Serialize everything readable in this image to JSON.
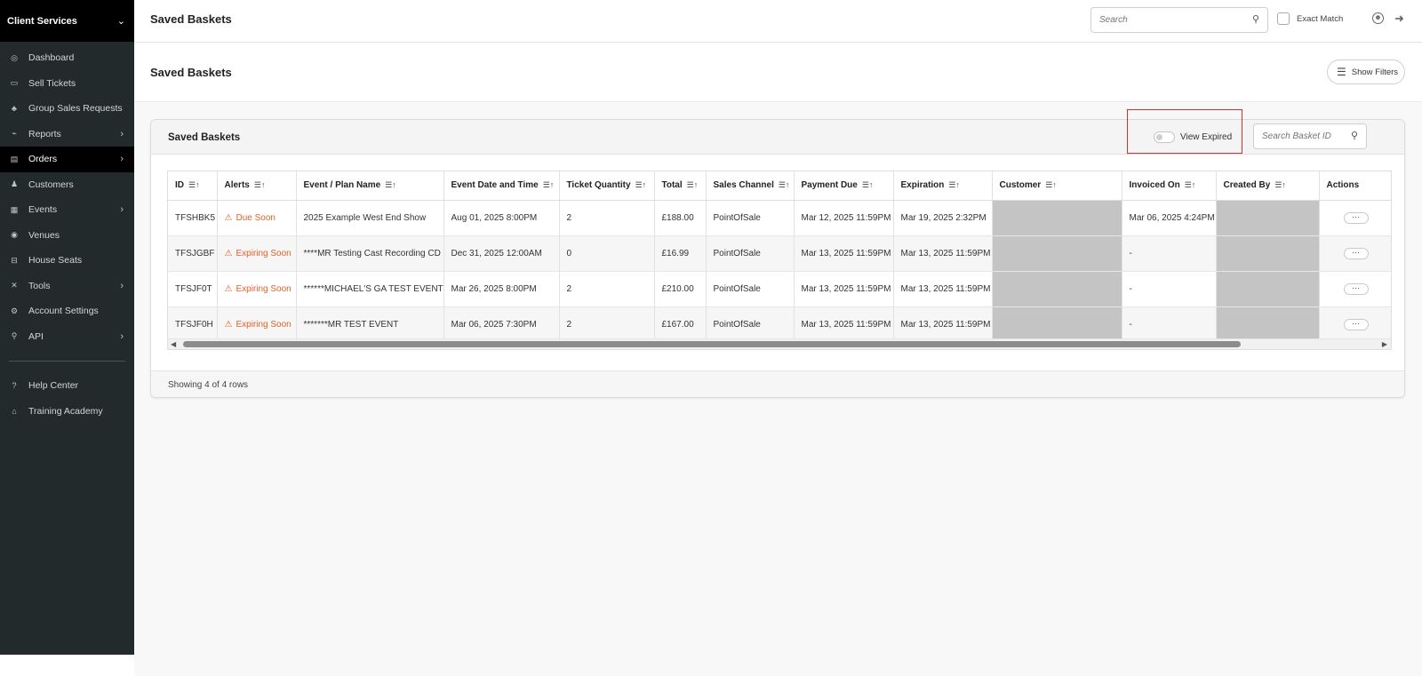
{
  "sidebar": {
    "header": "Client Services",
    "items": [
      {
        "label": "Dashboard",
        "icon": "dashboard-icon"
      },
      {
        "label": "Sell Tickets",
        "icon": "ticket-icon"
      },
      {
        "label": "Group Sales Requests",
        "icon": "group-icon"
      },
      {
        "label": "Reports",
        "icon": "chart-icon"
      },
      {
        "label": "Orders",
        "icon": "orders-icon"
      },
      {
        "label": "Customers",
        "icon": "users-icon"
      },
      {
        "label": "Events",
        "icon": "calendar-icon"
      },
      {
        "label": "Venues",
        "icon": "location-icon"
      },
      {
        "label": "House Seats",
        "icon": "seat-icon"
      },
      {
        "label": "Tools",
        "icon": "tools-icon"
      },
      {
        "label": "Account Settings",
        "icon": "settings-icon"
      },
      {
        "label": "API",
        "icon": "api-icon"
      }
    ],
    "bottom_items": [
      {
        "label": "Help Center",
        "icon": "help-icon"
      },
      {
        "label": "Training Academy",
        "icon": "academy-icon"
      }
    ]
  },
  "topbar": {
    "title": "Saved Baskets",
    "search_placeholder": "Search",
    "exact_match_label": "Exact Match"
  },
  "page": {
    "title": "Saved Baskets",
    "show_filters_label": "Show Filters"
  },
  "card": {
    "title": "Saved Baskets",
    "view_expired_label": "View Expired",
    "basket_search_placeholder": "Search Basket ID",
    "footer": "Showing 4 of 4 rows"
  },
  "table": {
    "columns": [
      "ID",
      "Alerts",
      "Event / Plan Name",
      "Event Date and Time",
      "Ticket Quantity",
      "Total",
      "Sales Channel",
      "Payment Due",
      "Expiration",
      "Customer",
      "Invoiced On",
      "Created By",
      "Actions"
    ],
    "rows": [
      {
        "id": "TFSHBK5",
        "alert": "Due Soon",
        "event": "2025 Example West End Show",
        "date": "Aug 01, 2025 8:00PM",
        "qty": "2",
        "total": "£188.00",
        "channel": "PointOfSale",
        "payment_due": "Mar 12, 2025 11:59PM",
        "expiration": "Mar 19, 2025 2:32PM",
        "invoiced": "Mar 06, 2025 4:24PM",
        "actions": "···"
      },
      {
        "id": "TFSJGBF",
        "alert": "Expiring Soon",
        "event": "****MR Testing Cast Recording CD",
        "date": "Dec 31, 2025 12:00AM",
        "qty": "0",
        "total": "£16.99",
        "channel": "PointOfSale",
        "payment_due": "Mar 13, 2025 11:59PM",
        "expiration": "Mar 13, 2025 11:59PM",
        "invoiced": "-",
        "actions": "···"
      },
      {
        "id": "TFSJF0T",
        "alert": "Expiring Soon",
        "event": "******MICHAEL'S GA TEST EVENT",
        "date": "Mar 26, 2025 8:00PM",
        "qty": "2",
        "total": "£210.00",
        "channel": "PointOfSale",
        "payment_due": "Mar 13, 2025 11:59PM",
        "expiration": "Mar 13, 2025 11:59PM",
        "invoiced": "-",
        "actions": "···"
      },
      {
        "id": "TFSJF0H",
        "alert": "Expiring Soon",
        "event": "*******MR TEST EVENT",
        "date": "Mar 06, 2025 7:30PM",
        "qty": "2",
        "total": "£167.00",
        "channel": "PointOfSale",
        "payment_due": "Mar 13, 2025 11:59PM",
        "expiration": "Mar 13, 2025 11:59PM",
        "invoiced": "-",
        "actions": "···"
      }
    ]
  },
  "colors": {
    "sidebar_bg": "#232a2c",
    "sidebar_active": "#000000",
    "alert_orange": "#e2622a",
    "highlight_red": "#d32f2f"
  }
}
